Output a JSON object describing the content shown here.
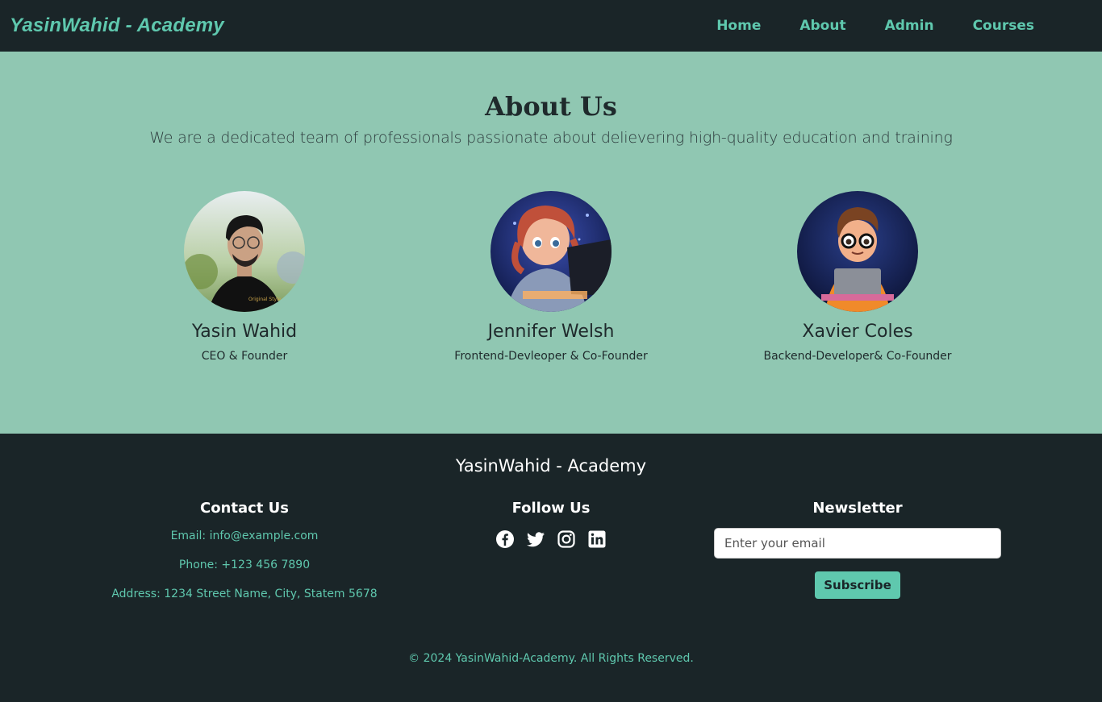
{
  "navbar": {
    "brand": "YasinWahid - Academy",
    "links": [
      "Home",
      "About",
      "Admin",
      "Courses"
    ]
  },
  "about": {
    "title": "About Us",
    "subtitle": "We are a dedicated team of professionals passionate about delievering high-quality education and training",
    "members": [
      {
        "name": "Yasin Wahid",
        "role": "CEO & Founder"
      },
      {
        "name": "Jennifer Welsh",
        "role": "Frontend-Devleoper & Co-Founder"
      },
      {
        "name": "Xavier Coles",
        "role": "Backend-Developer& Co-Founder"
      }
    ]
  },
  "footer": {
    "brand": "YasinWahid - Academy",
    "contact": {
      "title": "Contact Us",
      "email": "Email: info@example.com",
      "phone": "Phone: +123 456 7890",
      "address": "Address: 1234 Street Name, City, Statem 5678"
    },
    "follow": {
      "title": "Follow Us",
      "icons": [
        "facebook-icon",
        "twitter-icon",
        "instagram-icon",
        "linkedin-icon"
      ]
    },
    "newsletter": {
      "title": "Newsletter",
      "placeholder": "Enter your email",
      "button": "Subscribe"
    },
    "copyright": "© 2024 YasinWahid-Academy. All Rights Reserved."
  },
  "colors": {
    "dark": "#1a2528",
    "accent": "#5fc8ae",
    "about_bg": "#90c7b2"
  }
}
